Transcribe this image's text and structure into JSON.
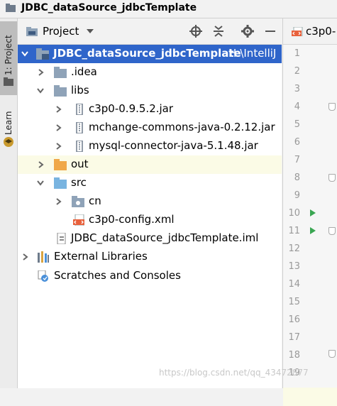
{
  "window": {
    "title": "JDBC_dataSource_jdbcTemplate"
  },
  "tool_stripe": {
    "project_tab": "1: Project",
    "learn_tab": "Learn"
  },
  "project_panel": {
    "title": "Project"
  },
  "tree": [
    {
      "label": "JDBC_dataSource_jdbcTemplate",
      "path": "H:\\IntelliJ",
      "icon": "module-folder-icon"
    },
    {
      "label": ".idea",
      "icon": "folder-icon"
    },
    {
      "label": "libs",
      "icon": "folder-icon"
    },
    {
      "label": "c3p0-0.9.5.2.jar",
      "icon": "jar-icon"
    },
    {
      "label": "mchange-commons-java-0.2.12.jar",
      "icon": "jar-icon"
    },
    {
      "label": "mysql-connector-java-5.1.48.jar",
      "icon": "jar-icon"
    },
    {
      "label": "out",
      "icon": "excluded-folder-icon"
    },
    {
      "label": "src",
      "icon": "source-folder-icon"
    },
    {
      "label": "cn",
      "icon": "package-icon"
    },
    {
      "label": "c3p0-config.xml",
      "icon": "xml-file-icon"
    },
    {
      "label": "JDBC_dataSource_jdbcTemplate.iml",
      "icon": "iml-file-icon"
    },
    {
      "label": "External Libraries",
      "icon": "libraries-icon"
    },
    {
      "label": "Scratches and Consoles",
      "icon": "scratches-icon"
    }
  ],
  "editor": {
    "tab_label": "c3p0-",
    "line_numbers": [
      "1",
      "2",
      "3",
      "4",
      "5",
      "6",
      "7",
      "8",
      "9",
      "10",
      "11",
      "12",
      "13",
      "14",
      "15",
      "16",
      "17",
      "18",
      "19"
    ]
  },
  "watermark": "https://blog.csdn.net/qq_43472877",
  "colors": {
    "selection": "#2f65ca",
    "highlight": "#fbfbe6",
    "run": "#3aa652",
    "folder": "#8fa3b8",
    "out_folder": "#f0a848",
    "src_folder": "#79b4e0"
  }
}
